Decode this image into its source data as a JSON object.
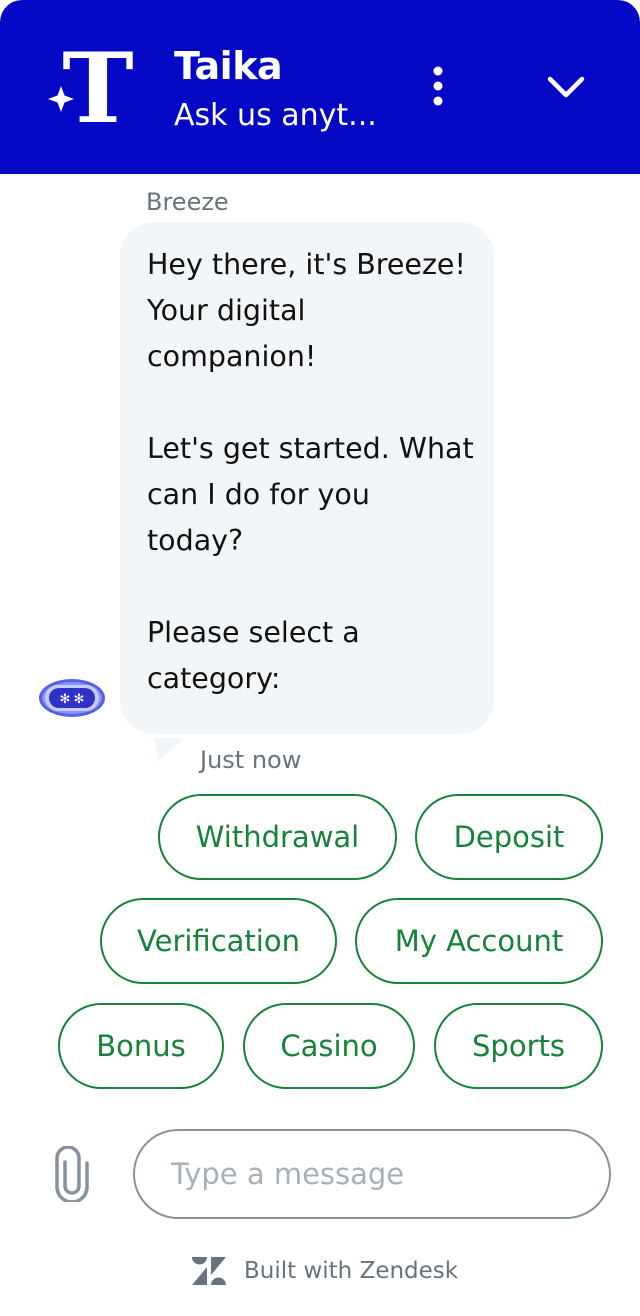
{
  "header": {
    "title": "Taika",
    "subtitle": "Ask us anyt...",
    "logo_icon": "taika-logo-icon",
    "menu_icon": "more-vertical-icon",
    "collapse_icon": "chevron-down-icon",
    "background_color": "#0509c6"
  },
  "conversation": {
    "sender": "Breeze",
    "message": "Hey there, it's Breeze! Your digital companion!\n\nLet's get started. What can I do for you today?\n\nPlease select a category:",
    "timestamp": "Just now",
    "avatar_icon": "robot-avatar-icon"
  },
  "quick_replies": [
    "Withdrawal",
    "Deposit",
    "Verification",
    "My Account",
    "Bonus",
    "Casino",
    "Sports"
  ],
  "composer": {
    "placeholder": "Type a message",
    "attach_icon": "paperclip-icon"
  },
  "footer": {
    "text": "Built with Zendesk",
    "logo_icon": "zendesk-logo-icon"
  },
  "colors": {
    "accent_green": "#17833a",
    "bubble_background": "#f3f6f9",
    "muted_text": "#68737d"
  }
}
